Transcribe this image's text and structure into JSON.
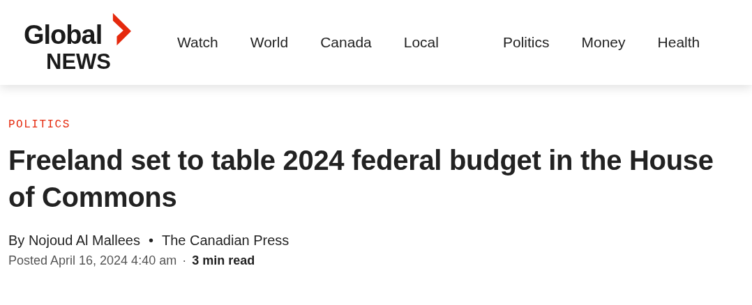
{
  "logo": {
    "line_1": "Global",
    "line_2": "NEWS"
  },
  "nav": [
    {
      "label": "Watch"
    },
    {
      "label": "World"
    },
    {
      "label": "Canada"
    },
    {
      "label": "Local"
    },
    {
      "label": "Politics"
    },
    {
      "label": "Money"
    },
    {
      "label": "Health"
    }
  ],
  "article": {
    "category": "POLITICS",
    "headline": "Freeland set to table 2024 federal budget in the House of Commons",
    "author": "By Nojoud Al Mallees",
    "separator": "•",
    "source": "The Canadian Press",
    "posted": "Posted April 16, 2024 4:40 am",
    "dot": "·",
    "read_time": "3 min read"
  }
}
